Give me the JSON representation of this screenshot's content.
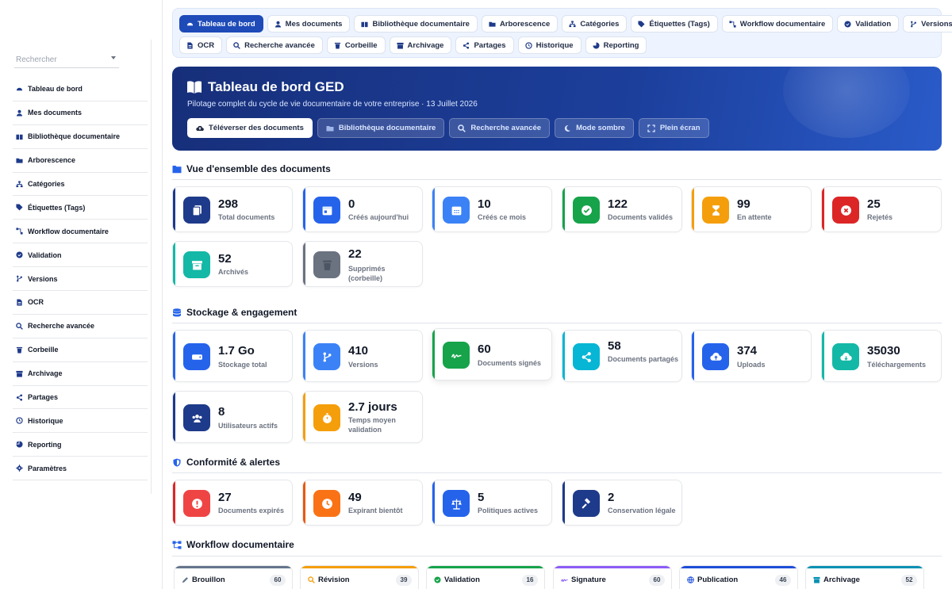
{
  "sidebar": {
    "search_placeholder": "Rechercher",
    "items": [
      {
        "label": "Tableau de bord",
        "icon": "dashboard-icon"
      },
      {
        "label": "Mes documents",
        "icon": "user-icon"
      },
      {
        "label": "Bibliothèque documentaire",
        "icon": "book-icon"
      },
      {
        "label": "Arborescence",
        "icon": "folder-open-icon"
      },
      {
        "label": "Catégories",
        "icon": "sitemap-icon"
      },
      {
        "label": "Étiquettes (Tags)",
        "icon": "tag-icon"
      },
      {
        "label": "Workflow documentaire",
        "icon": "workflow-icon"
      },
      {
        "label": "Validation",
        "icon": "check-circle-icon"
      },
      {
        "label": "Versions",
        "icon": "branch-icon"
      },
      {
        "label": "OCR",
        "icon": "file-text-icon"
      },
      {
        "label": "Recherche avancée",
        "icon": "search-icon"
      },
      {
        "label": "Corbeille",
        "icon": "trash-icon"
      },
      {
        "label": "Archivage",
        "icon": "archive-icon"
      },
      {
        "label": "Partages",
        "icon": "share-icon"
      },
      {
        "label": "Historique",
        "icon": "history-icon"
      },
      {
        "label": "Reporting",
        "icon": "pie-chart-icon"
      },
      {
        "label": "Paramètres",
        "icon": "gear-icon"
      }
    ]
  },
  "nav": {
    "row1": [
      "Tableau de bord",
      "Mes documents",
      "Bibliothèque documentaire",
      "Arborescence",
      "Catégories",
      "Étiquettes (Tags)",
      "Workflow documentaire",
      "Validation",
      "Versions"
    ],
    "row2": [
      "OCR",
      "Recherche avancée",
      "Corbeille",
      "Archivage",
      "Partages",
      "Historique",
      "Reporting"
    ]
  },
  "hero": {
    "title": "Tableau de bord GED",
    "subtitle": "Pilotage complet du cycle de vie documentaire de votre entreprise · 13 Juillet 2026",
    "actions": [
      "Téléverser des documents",
      "Bibliothèque documentaire",
      "Recherche avancée",
      "Mode sombre",
      "Plein écran"
    ]
  },
  "sections": {
    "overview": "Vue d'ensemble des documents",
    "storage": "Stockage & engagement",
    "compliance": "Conformité & alertes",
    "workflow": "Workflow documentaire"
  },
  "overview_cards": [
    {
      "value": "298",
      "label": "Total documents",
      "color": "#1e3a8a"
    },
    {
      "value": "0",
      "label": "Créés aujourd'hui",
      "color": "#2563eb"
    },
    {
      "value": "10",
      "label": "Créés ce mois",
      "color": "#3b82f6"
    },
    {
      "value": "122",
      "label": "Documents validés",
      "color": "#16a34a"
    },
    {
      "value": "99",
      "label": "En attente",
      "color": "#f59e0b"
    },
    {
      "value": "25",
      "label": "Rejetés",
      "color": "#dc2626"
    },
    {
      "value": "52",
      "label": "Archivés",
      "color": "#14b8a6"
    },
    {
      "value": "22",
      "label": "Supprimés (corbeille)",
      "color": "#6b7280"
    }
  ],
  "storage_cards": [
    {
      "value": "1.7 Go",
      "label": "Stockage total",
      "color": "#2563eb"
    },
    {
      "value": "410",
      "label": "Versions",
      "color": "#3b82f6"
    },
    {
      "value": "60",
      "label": "Documents signés",
      "color": "#16a34a"
    },
    {
      "value": "58",
      "label": "Documents partagés",
      "color": "#06b6d4"
    },
    {
      "value": "374",
      "label": "Uploads",
      "color": "#2563eb"
    },
    {
      "value": "35030",
      "label": "Téléchargements",
      "color": "#14b8a6"
    },
    {
      "value": "8",
      "label": "Utilisateurs actifs",
      "color": "#1e3a8a"
    },
    {
      "value": "2.7 jours",
      "label": "Temps moyen validation",
      "color": "#f59e0b"
    }
  ],
  "compliance_cards": [
    {
      "value": "27",
      "label": "Documents expirés",
      "color": "#dc2626"
    },
    {
      "value": "49",
      "label": "Expirant bientôt",
      "color": "#ea580c"
    },
    {
      "value": "5",
      "label": "Politiques actives",
      "color": "#2563eb"
    },
    {
      "value": "2",
      "label": "Conservation légale",
      "color": "#1e3a8a"
    }
  ],
  "workflow_stages": [
    {
      "name": "Brouillon",
      "count": "60",
      "color": "#64748b"
    },
    {
      "name": "Révision",
      "count": "39",
      "color": "#f59e0b"
    },
    {
      "name": "Validation",
      "count": "16",
      "color": "#16a34a"
    },
    {
      "name": "Signature",
      "count": "60",
      "color": "#8b5cf6"
    },
    {
      "name": "Publication",
      "count": "46",
      "color": "#1d4ed8"
    },
    {
      "name": "Archivage",
      "count": "52",
      "color": "#0891b2"
    }
  ]
}
